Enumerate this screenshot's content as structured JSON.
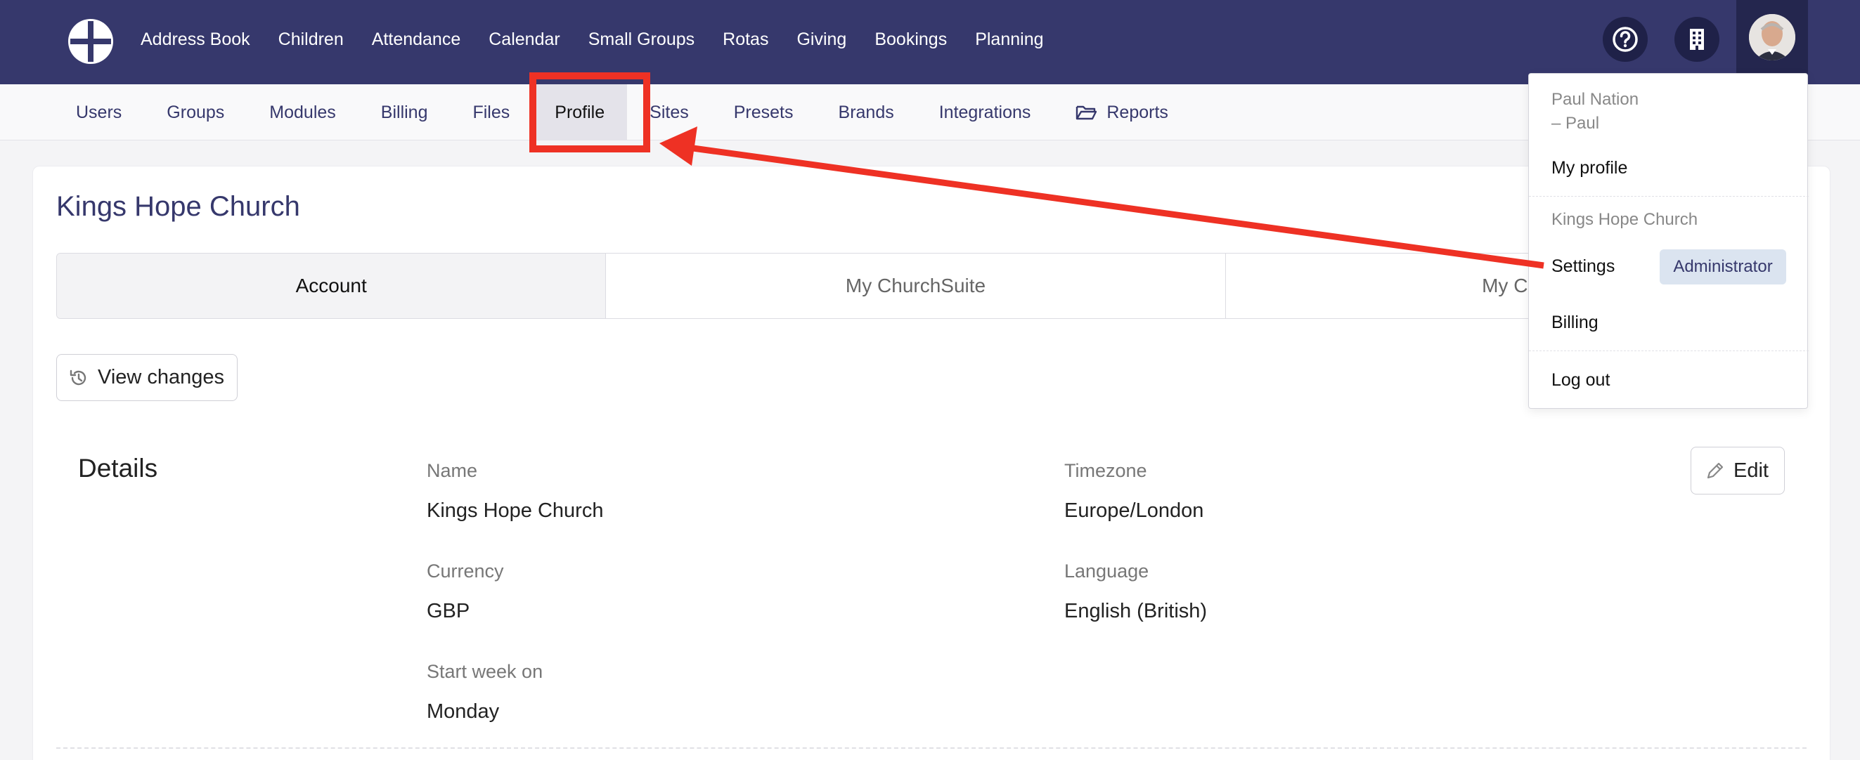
{
  "main_nav": {
    "items": [
      "Address Book",
      "Children",
      "Attendance",
      "Calendar",
      "Small Groups",
      "Rotas",
      "Giving",
      "Bookings",
      "Planning"
    ]
  },
  "icons": {
    "logo": "cross-circle-logo-icon",
    "help": "question-circle-icon",
    "building": "building-icon",
    "history": "history-icon",
    "pencil": "pencil-icon",
    "folder": "folder-open-icon"
  },
  "sub_nav": {
    "items": [
      "Users",
      "Groups",
      "Modules",
      "Billing",
      "Files",
      "Profile",
      "Sites",
      "Presets",
      "Brands",
      "Integrations"
    ],
    "reports_label": "Reports",
    "active": "Profile"
  },
  "page": {
    "title": "Kings Hope Church",
    "tabs": [
      "Account",
      "My ChurchSuite",
      "My Con"
    ],
    "active_tab": "Account",
    "view_changes_label": "View changes",
    "edit_label": "Edit"
  },
  "details": {
    "heading": "Details",
    "fields": {
      "name_label": "Name",
      "name_value": "Kings Hope Church",
      "timezone_label": "Timezone",
      "timezone_value": "Europe/London",
      "currency_label": "Currency",
      "currency_value": "GBP",
      "language_label": "Language",
      "language_value": "English (British)",
      "start_week_label": "Start week on",
      "start_week_value": "Monday"
    }
  },
  "dropdown": {
    "user_name": "Paul Nation",
    "user_nickname": "– Paul",
    "my_profile": "My profile",
    "org_name": "Kings Hope Church",
    "settings": "Settings",
    "role_badge": "Administrator",
    "billing": "Billing",
    "log_out": "Log out"
  },
  "colors": {
    "nav_bg": "#36386c",
    "accent": "#36386c",
    "annotation": "#ee3124",
    "badge_bg": "#dbe4f0"
  }
}
